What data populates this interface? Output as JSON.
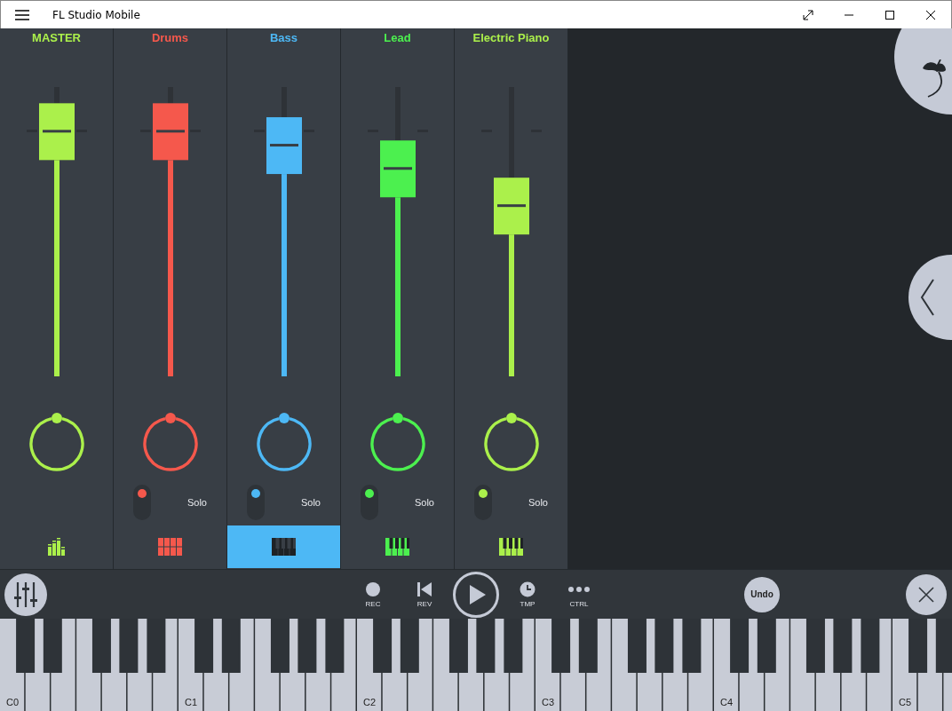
{
  "window": {
    "title": "FL Studio Mobile"
  },
  "channels": [
    {
      "name": "MASTER",
      "color": "#abf04b",
      "level": 0.93,
      "kind": "mixer",
      "selected": false
    },
    {
      "name": "Drums",
      "color": "#f5584c",
      "level": 0.93,
      "kind": "pads",
      "selected": false,
      "solo": {
        "label": "Solo",
        "on": false
      }
    },
    {
      "name": "Bass",
      "color": "#4db8f5",
      "level": 0.87,
      "kind": "piano",
      "selected": true,
      "solo": {
        "label": "Solo",
        "on": false
      }
    },
    {
      "name": "Lead",
      "color": "#4cf04f",
      "level": 0.77,
      "kind": "piano",
      "selected": false,
      "solo": {
        "label": "Solo",
        "on": false
      }
    },
    {
      "name": "Electric Piano",
      "color": "#abf04b",
      "level": 0.61,
      "kind": "piano",
      "selected": false,
      "solo": {
        "label": "Solo",
        "on": false
      }
    }
  ],
  "toolbar": {
    "transport": [
      {
        "kind": "record",
        "label": "REC"
      },
      {
        "kind": "rewind",
        "label": "REV"
      },
      {
        "kind": "play"
      },
      {
        "kind": "tempo",
        "label": "TMP"
      },
      {
        "kind": "control",
        "label": "CTRL"
      }
    ],
    "undo": "Undo"
  },
  "keyboard": {
    "octave_labels": [
      "C0",
      "C1",
      "C2",
      "C3",
      "C4",
      "C5"
    ]
  }
}
